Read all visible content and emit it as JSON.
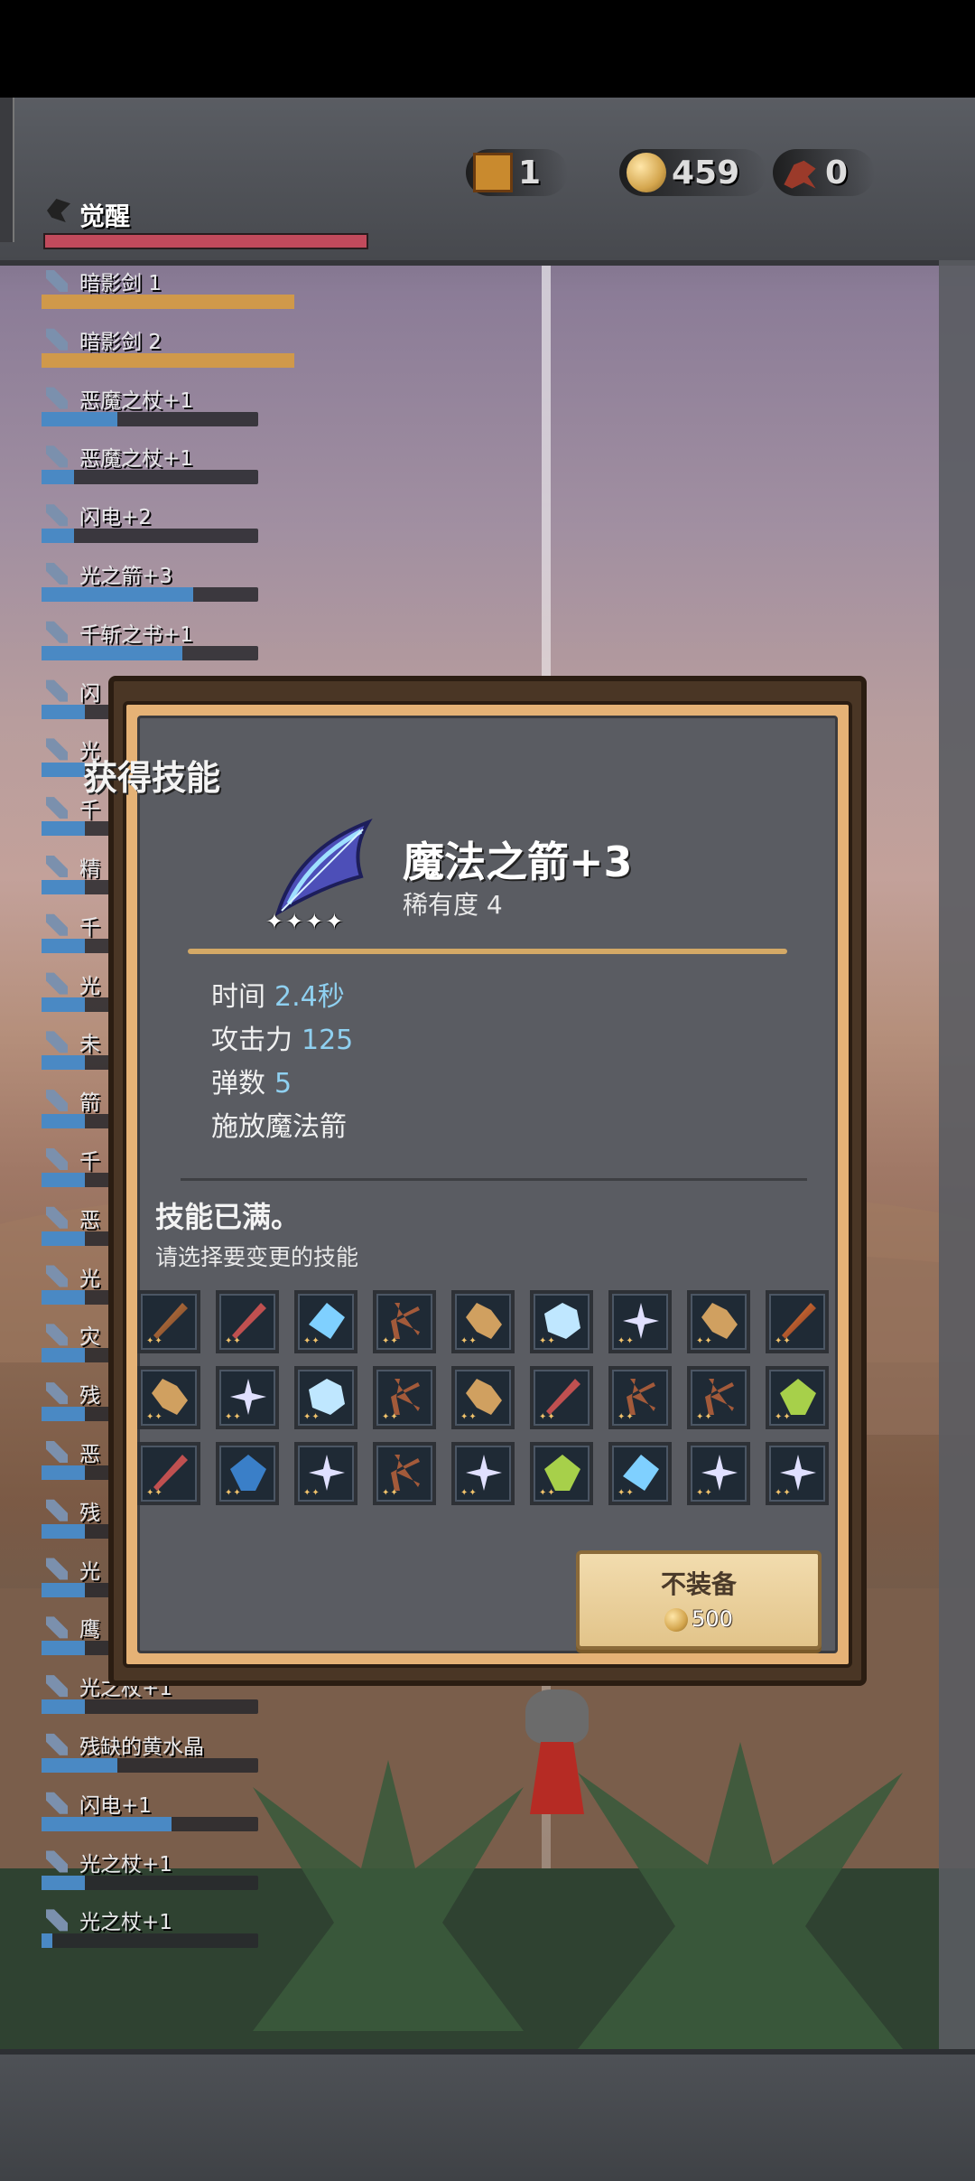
{
  "hud": {
    "chests": "1",
    "coins": "459",
    "kills": "0",
    "awaken_label": "觉醒"
  },
  "skills_list": [
    {
      "label": "暗影剑 1",
      "fill": 1.0,
      "style": "gold"
    },
    {
      "label": "暗影剑 2",
      "fill": 1.0,
      "style": "gold"
    },
    {
      "label": "恶魔之杖+1",
      "fill": 0.35,
      "style": "blue"
    },
    {
      "label": "恶魔之杖+1",
      "fill": 0.15,
      "style": "blue"
    },
    {
      "label": "闪电+2",
      "fill": 0.15,
      "style": "blue"
    },
    {
      "label": "光之箭+3",
      "fill": 0.7,
      "style": "blue"
    },
    {
      "label": "千斩之书+1",
      "fill": 0.65,
      "style": "blue"
    },
    {
      "label": "闪",
      "fill": 0.2,
      "style": "blue"
    },
    {
      "label": "光",
      "fill": 0.2,
      "style": "blue"
    },
    {
      "label": "千",
      "fill": 0.2,
      "style": "blue"
    },
    {
      "label": "精",
      "fill": 0.2,
      "style": "blue"
    },
    {
      "label": "千",
      "fill": 0.2,
      "style": "blue"
    },
    {
      "label": "光",
      "fill": 0.2,
      "style": "blue"
    },
    {
      "label": "未",
      "fill": 0.2,
      "style": "blue"
    },
    {
      "label": "箭",
      "fill": 0.2,
      "style": "blue"
    },
    {
      "label": "千",
      "fill": 0.2,
      "style": "blue"
    },
    {
      "label": "恶",
      "fill": 0.2,
      "style": "blue"
    },
    {
      "label": "光",
      "fill": 0.2,
      "style": "blue"
    },
    {
      "label": "灾",
      "fill": 0.2,
      "style": "blue"
    },
    {
      "label": "残",
      "fill": 0.2,
      "style": "blue"
    },
    {
      "label": "恶",
      "fill": 0.2,
      "style": "blue"
    },
    {
      "label": "残",
      "fill": 0.2,
      "style": "blue"
    },
    {
      "label": "光",
      "fill": 0.2,
      "style": "blue"
    },
    {
      "label": "鹰",
      "fill": 0.2,
      "style": "blue"
    },
    {
      "label": "光之杖+1",
      "fill": 0.2,
      "style": "blue"
    },
    {
      "label": "残缺的黄水晶",
      "fill": 0.35,
      "style": "blue"
    },
    {
      "label": "闪电+1",
      "fill": 0.6,
      "style": "blue"
    },
    {
      "label": "光之杖+1",
      "fill": 0.2,
      "style": "blue"
    },
    {
      "label": "光之杖+1",
      "fill": 0.05,
      "style": "blue"
    }
  ],
  "modal": {
    "title": "获得技能",
    "skill_name": "魔法之箭+3",
    "rarity": "稀有度 4",
    "stars": "✦✦✦✦",
    "stats": {
      "time_label": "时间",
      "time_value": "2.4秒",
      "attack_label": "攻击力",
      "attack_value": "125",
      "bullets_label": "弹数",
      "bullets_value": "5",
      "desc": "施放魔法箭"
    },
    "full_msg": "技能已满。",
    "choose_msg": "请选择要变更的技能",
    "grid": [
      "sword",
      "staff",
      "crystal",
      "bow",
      "scroll",
      "ice",
      "shine",
      "scroll",
      "fire",
      "scroll",
      "shine",
      "ice",
      "bow",
      "scroll",
      "staff",
      "bow",
      "bow",
      "gem",
      "staff",
      "blue",
      "shine",
      "bow",
      "shine",
      "gem",
      "crystal",
      "shine",
      "shine"
    ],
    "unequip_label": "不装备",
    "unequip_cost": "500"
  }
}
